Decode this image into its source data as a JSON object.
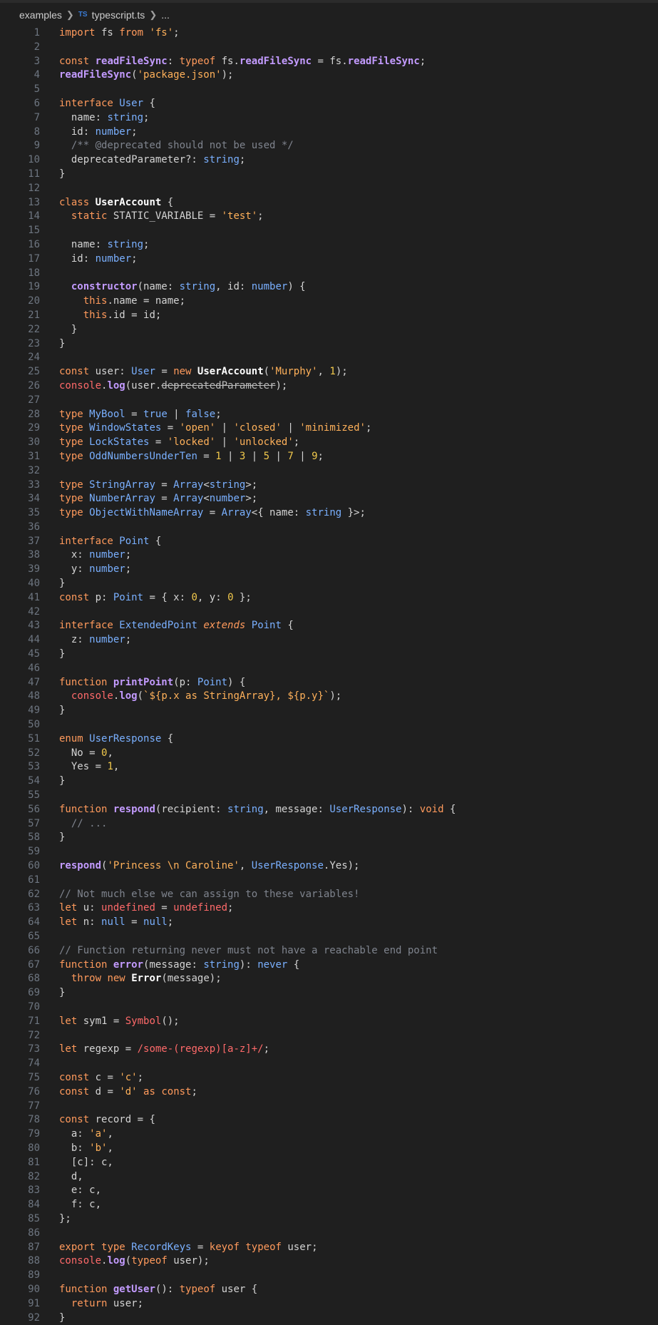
{
  "breadcrumb": {
    "folder": "examples",
    "lang_badge": "TS",
    "file": "typescript.ts",
    "more": "..."
  },
  "editor": {
    "lines": [
      "import fs from 'fs';",
      "",
      "const readFileSync: typeof fs.readFileSync = fs.readFileSync;",
      "readFileSync('package.json');",
      "",
      "interface User {",
      "  name: string;",
      "  id: number;",
      "  /** @deprecated should not be used */",
      "  deprecatedParameter?: string;",
      "}",
      "",
      "class UserAccount {",
      "  static STATIC_VARIABLE = 'test';",
      "",
      "  name: string;",
      "  id: number;",
      "",
      "  constructor(name: string, id: number) {",
      "    this.name = name;",
      "    this.id = id;",
      "  }",
      "}",
      "",
      "const user: User = new UserAccount('Murphy', 1);",
      "console.log(user.deprecatedParameter);",
      "",
      "type MyBool = true | false;",
      "type WindowStates = 'open' | 'closed' | 'minimized';",
      "type LockStates = 'locked' | 'unlocked';",
      "type OddNumbersUnderTen = 1 | 3 | 5 | 7 | 9;",
      "",
      "type StringArray = Array<string>;",
      "type NumberArray = Array<number>;",
      "type ObjectWithNameArray = Array<{ name: string }>;",
      "",
      "interface Point {",
      "  x: number;",
      "  y: number;",
      "}",
      "const p: Point = { x: 0, y: 0 };",
      "",
      "interface ExtendedPoint extends Point {",
      "  z: number;",
      "}",
      "",
      "function printPoint(p: Point) {",
      "  console.log(`${p.x as StringArray}, ${p.y}`);",
      "}",
      "",
      "enum UserResponse {",
      "  No = 0,",
      "  Yes = 1,",
      "}",
      "",
      "function respond(recipient: string, message: UserResponse): void {",
      "  // ...",
      "}",
      "",
      "respond('Princess \\n Caroline', UserResponse.Yes);",
      "",
      "// Not much else we can assign to these variables!",
      "let u: undefined = undefined;",
      "let n: null = null;",
      "",
      "// Function returning never must not have a reachable end point",
      "function error(message: string): never {",
      "  throw new Error(message);",
      "}",
      "",
      "let sym1 = Symbol();",
      "",
      "let regexp = /some-(regexp)[a-z]+/;",
      "",
      "const c = 'c';",
      "const d = 'd' as const;",
      "",
      "const record = {",
      "  a: 'a',",
      "  b: 'b',",
      "  [c]: c,",
      "  d,",
      "  e: c,",
      "  f: c,",
      "};",
      "",
      "export type RecordKeys = keyof typeof user;",
      "console.log(typeof user);",
      "",
      "function getUser(): typeof user {",
      "  return user;",
      "}"
    ]
  }
}
